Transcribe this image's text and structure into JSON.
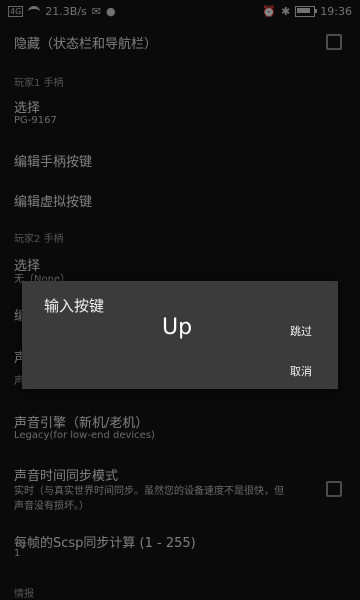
{
  "status_bar": {
    "signal": "4G",
    "speed": "21.3B/s",
    "time": "19:36"
  },
  "settings": {
    "hidden_label": "隐藏（状态栏和导航栏）",
    "player1_header": "玩家1 手柄",
    "select1_title": "选择",
    "select1_value": "PG-9167",
    "edit_pad_keys": "编辑手柄按键",
    "edit_virtual_keys": "编辑虚拟按键",
    "player2_header": "玩家2 手柄",
    "select2_title": "选择",
    "select2_value": "无（None）",
    "partial_edit": "编",
    "partial_sound": "声",
    "partial_sound2": "声",
    "sound_engine_title": "声音引擎（新机/老机）",
    "sound_engine_value": "Legacy(for low-end devices)",
    "sound_sync_title": "声音时间同步模式",
    "sound_sync_value1": "实时（与真实世界时间同步。虽然您的设备速度不是很快，但",
    "sound_sync_value2": "声音没有损坏。）",
    "scsp_title": "每帧的Scsp同步计算 (1 - 255)",
    "scsp_value": "1",
    "info_header": "情报"
  },
  "dialog": {
    "title": "输入按键",
    "key": "Up",
    "skip": "跳过",
    "cancel": "取消"
  }
}
